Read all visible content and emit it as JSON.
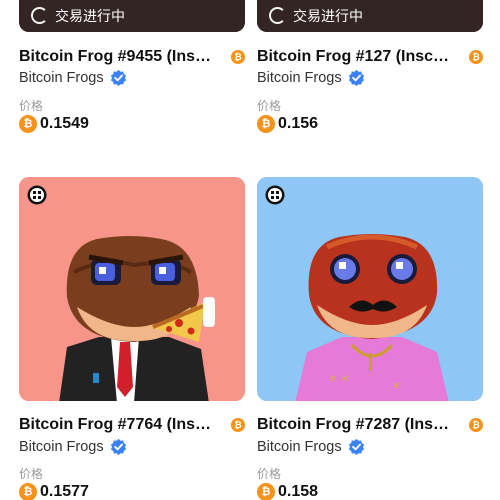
{
  "status_text": "交易进行中",
  "price_label": "价格",
  "btc_symbol": "₿",
  "cards": [
    {
      "title": "Bitcoin Frog #9455 (Ins…",
      "collection": "Bitcoin Frogs",
      "price": "0.1549",
      "bg_color": "#3a2a2a",
      "in_trade": true
    },
    {
      "title": "Bitcoin Frog #127 (Insc…",
      "collection": "Bitcoin Frogs",
      "price": "0.156",
      "bg_color": "#3a2a2a",
      "in_trade": true
    },
    {
      "title": "Bitcoin Frog #7764 (Ins…",
      "collection": "Bitcoin Frogs",
      "price": "0.1577",
      "bg_color": "#f7958a",
      "in_trade": false
    },
    {
      "title": "Bitcoin Frog #7287 (Ins…",
      "collection": "Bitcoin Frogs",
      "price": "0.158",
      "bg_color": "#8ec6f5",
      "in_trade": false
    }
  ]
}
